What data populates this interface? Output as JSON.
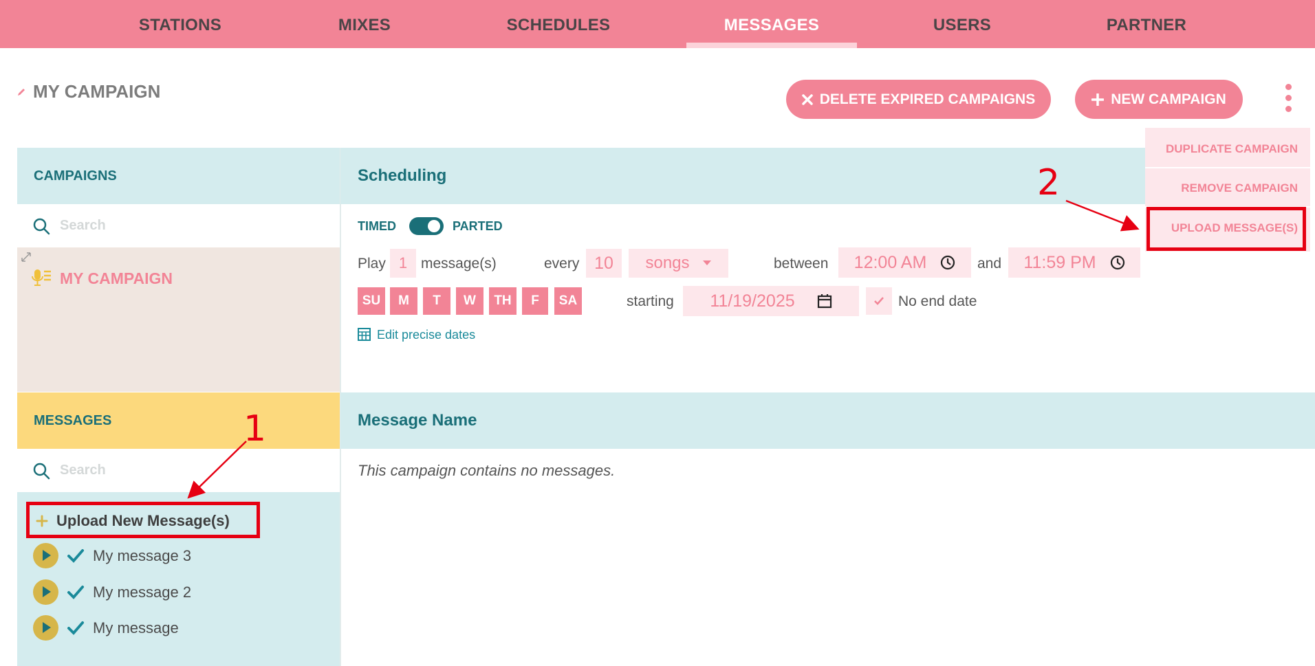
{
  "nav": {
    "items": [
      "STATIONS",
      "MIXES",
      "SCHEDULES",
      "MESSAGES",
      "USERS",
      "PARTNER"
    ],
    "active": "MESSAGES"
  },
  "header": {
    "title": "MY CAMPAIGN",
    "delete_expired_label": "DELETE EXPIRED CAMPAIGNS",
    "new_campaign_label": "NEW CAMPAIGN"
  },
  "menu": {
    "items": [
      "DUPLICATE CAMPAIGN",
      "REMOVE CAMPAIGN",
      "UPLOAD MESSAGE(S)"
    ]
  },
  "annotations": {
    "one": "1",
    "two": "2"
  },
  "campaigns": {
    "heading": "CAMPAIGNS",
    "search_placeholder": "Search",
    "items": [
      "MY CAMPAIGN"
    ]
  },
  "scheduling": {
    "heading": "Scheduling",
    "timed_label": "TIMED",
    "parted_label": "PARTED",
    "play_label": "Play",
    "play_count": "1",
    "messages_label": "message(s)",
    "every_label": "every",
    "every_count": "10",
    "unit": "songs",
    "between_label": "between",
    "start_time": "12:00 AM",
    "and_label": "and",
    "end_time": "11:59 PM",
    "days": [
      "SU",
      "M",
      "T",
      "W",
      "TH",
      "F",
      "SA"
    ],
    "starting_label": "starting",
    "start_date": "11/19/2025",
    "no_end_date_label": "No end date",
    "edit_dates_label": "Edit precise dates"
  },
  "messages": {
    "heading": "MESSAGES",
    "search_placeholder": "Search",
    "upload_label": "Upload New Message(s)",
    "items": [
      "My message 3",
      "My message 2",
      "My message"
    ]
  },
  "message_table": {
    "column_header": "Message Name",
    "empty_text": "This campaign contains no messages."
  },
  "colors": {
    "brand_pink": "#f28496",
    "teal": "#1a6f78",
    "light_teal": "#d4ecee",
    "yellow": "#fcd97d",
    "annotation_red": "#e60012"
  }
}
